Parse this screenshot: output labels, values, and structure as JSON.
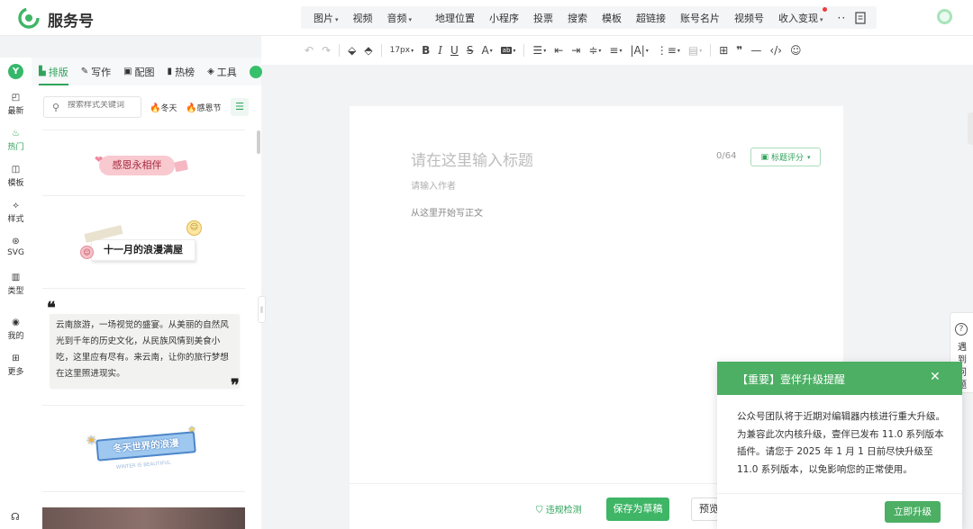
{
  "app": {
    "brand": "服务号",
    "brand_color": "#3fb566"
  },
  "topnav": {
    "group1": [
      {
        "label": "图片",
        "has_caret": true
      },
      {
        "label": "视频",
        "has_caret": false
      },
      {
        "label": "音频",
        "has_caret": true
      }
    ],
    "group2": [
      {
        "label": "地理位置"
      },
      {
        "label": "小程序"
      },
      {
        "label": "投票"
      },
      {
        "label": "搜索"
      },
      {
        "label": "模板"
      },
      {
        "label": "超链接"
      },
      {
        "label": "账号名片"
      },
      {
        "label": "视频号"
      },
      {
        "label": "收入变现",
        "has_caret": true,
        "red_dot": true
      },
      {
        "label": "···",
        "red_dot": true
      }
    ],
    "doc_icon": "document-icon",
    "avatar_icon": "avatar-icon"
  },
  "toolbar": {
    "font_size": "17px",
    "items": [
      "undo-icon",
      "redo-icon",
      "format-painter-icon",
      "clear-format-icon",
      "font-size",
      "bold-icon",
      "italic-icon",
      "underline-icon",
      "strikethrough-icon",
      "font-color-icon",
      "highlight-icon",
      "align-icon",
      "indent-left-icon",
      "indent-right-icon",
      "paragraph-spacing-icon",
      "line-height-icon",
      "letter-spacing-icon",
      "list-icon",
      "background-icon",
      "table-icon",
      "quote-icon",
      "divider-icon",
      "code-icon",
      "emoji-icon"
    ]
  },
  "rail": {
    "logo_letter": "Y",
    "items": [
      {
        "label": "最新",
        "icon": "chat-icon"
      },
      {
        "label": "热门",
        "icon": "flame-icon",
        "active": true
      },
      {
        "label": "模板",
        "icon": "template-icon"
      },
      {
        "label": "样式",
        "icon": "style-icon"
      },
      {
        "label": "SVG",
        "icon": "svg-icon"
      },
      {
        "label": "类型",
        "icon": "type-icon"
      },
      {
        "label": "我的",
        "icon": "user-icon"
      },
      {
        "label": "更多",
        "icon": "grid-icon"
      }
    ]
  },
  "tabs": [
    {
      "label": "排版",
      "icon": "layout-icon",
      "active": true
    },
    {
      "label": "写作",
      "icon": "pen-icon"
    },
    {
      "label": "配图",
      "icon": "image-icon"
    },
    {
      "label": "热榜",
      "icon": "bookmark-icon"
    },
    {
      "label": "工具",
      "icon": "cube-icon"
    }
  ],
  "panel": {
    "search_placeholder": "搜索样式关键词",
    "hot_tags": [
      "冬天",
      "感恩节"
    ],
    "cards": {
      "thanks": "感恩永相伴",
      "november": "十一月的浪漫满屋",
      "yunnan": "云南旅游，一场视觉的盛宴。从美丽的自然风光到千年的历史文化，从民族风情到美食小吃，这里应有尽有。来云南，让你的旅行梦想在这里照进现实。",
      "winter": "冬天世界的浪漫",
      "winter_sub": "WINTER IS BEAUTIFUL"
    }
  },
  "editor": {
    "title_placeholder": "请在这里输入标题",
    "title_counter": "0/64",
    "score_button": "标题评分",
    "author_placeholder": "请输入作者",
    "body_placeholder": "从这里开始写正文"
  },
  "actions": {
    "check": "违规检测",
    "save": "保存为草稿",
    "preview": "预览"
  },
  "help_float": {
    "text": "遇到问题"
  },
  "notice": {
    "title": "【重要】壹伴升级提醒",
    "body": "公众号团队将于近期对编辑器内核进行重大升级。为兼容此次内核升级，壹伴已发布 11.0 系列版本插件。请您于 2025 年 1 月 1 日前尽快升级至 11.0 系列版本，以免影响您的正常使用。",
    "button": "立即升级"
  }
}
